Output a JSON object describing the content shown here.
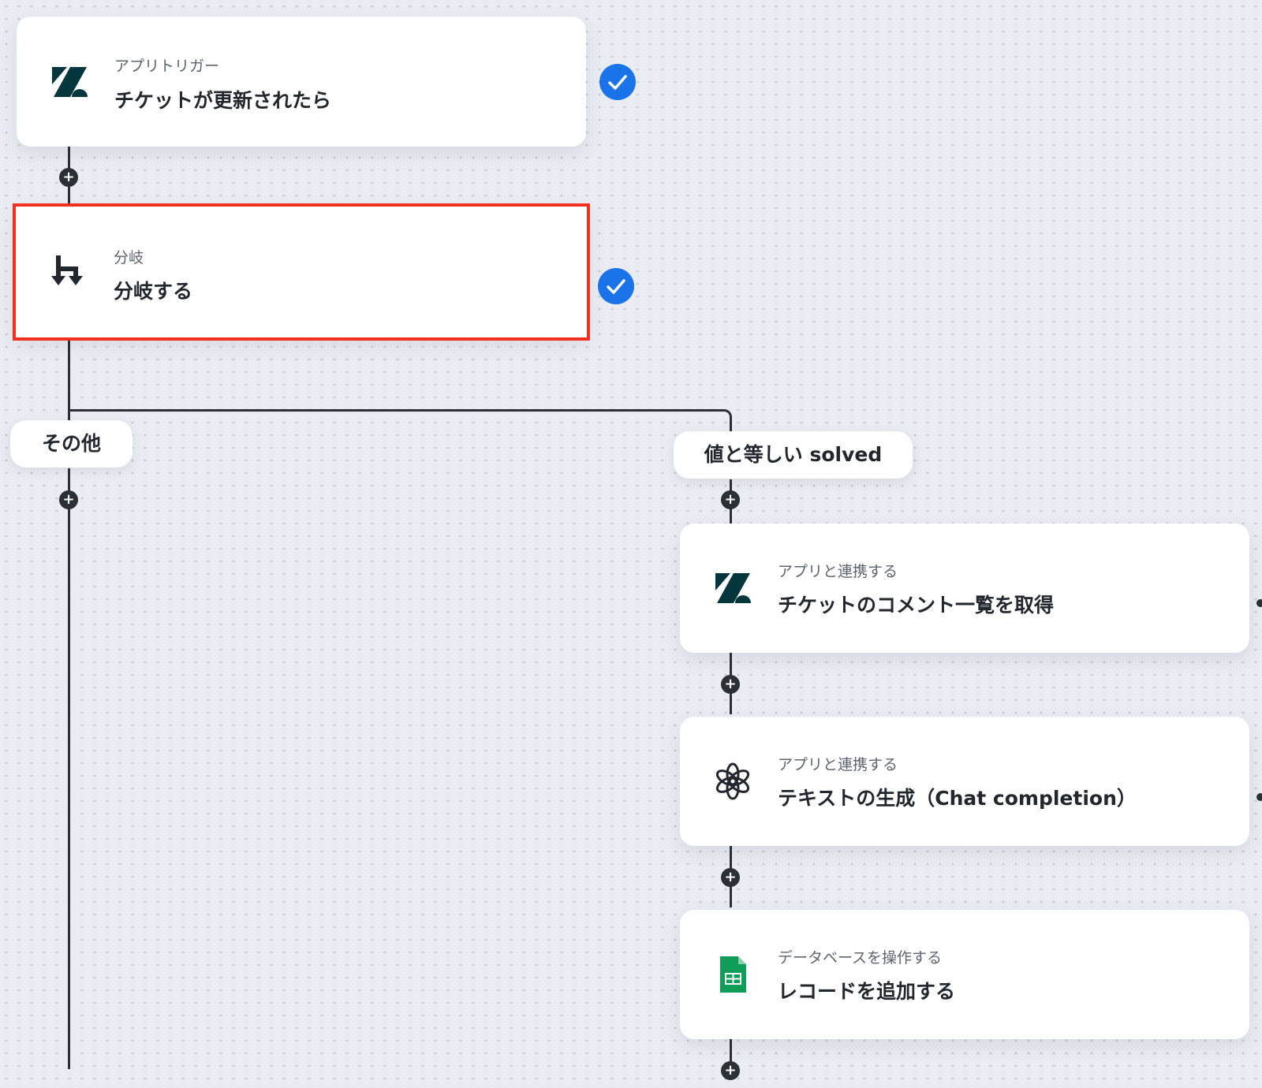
{
  "flow": {
    "trigger": {
      "subtitle": "アプリトリガー",
      "title": "チケットが更新されたら",
      "icon": "zendesk-icon",
      "status": "checked"
    },
    "branch": {
      "subtitle": "分岐",
      "title": "分岐する",
      "icon": "branch-icon",
      "status": "checked",
      "selected": true
    },
    "branch_labels": {
      "other": "その他",
      "condition": "値と等しい solved"
    },
    "steps": [
      {
        "subtitle": "アプリと連携する",
        "title": "チケットのコメント一覧を取得",
        "icon": "zendesk-icon"
      },
      {
        "subtitle": "アプリと連携する",
        "title": "テキストの生成（Chat completion）",
        "icon": "openai-icon"
      },
      {
        "subtitle": "データベースを操作する",
        "title": "レコードを追加する",
        "icon": "google-sheets-icon"
      }
    ]
  },
  "colors": {
    "accent": "#1a73e8",
    "selection": "#f2301f",
    "connector": "#2b2f36",
    "sheets_green": "#0f9d58",
    "zendesk": "#03363d"
  }
}
